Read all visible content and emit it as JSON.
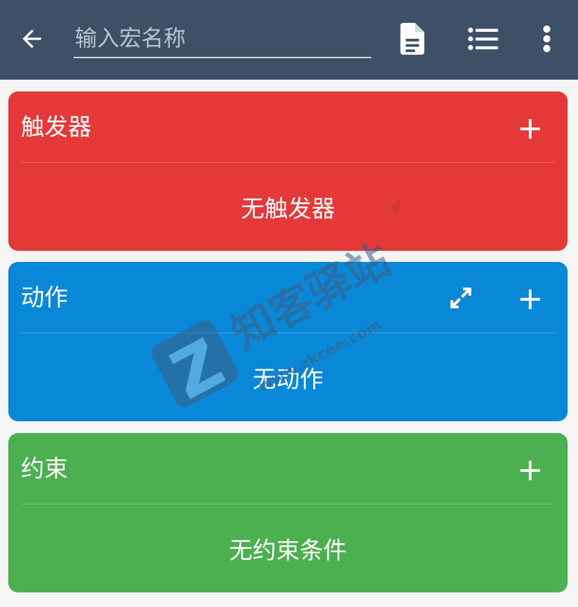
{
  "header": {
    "name_placeholder": "输入宏名称",
    "bg_color": "#3d5068",
    "icons": [
      "back-arrow-icon",
      "document-icon",
      "list-icon",
      "more-vert-icon"
    ]
  },
  "sections": {
    "triggers": {
      "title": "触发器",
      "empty_text": "无触发器",
      "color": "#e53838"
    },
    "actions": {
      "title": "动作",
      "empty_text": "无动作",
      "color": "#0a88d8"
    },
    "constraints": {
      "title": "约束",
      "empty_text": "无约束条件",
      "color": "#4caf50"
    }
  },
  "watermark": {
    "title": "知客驿站",
    "url": "www.zkcee.com"
  }
}
